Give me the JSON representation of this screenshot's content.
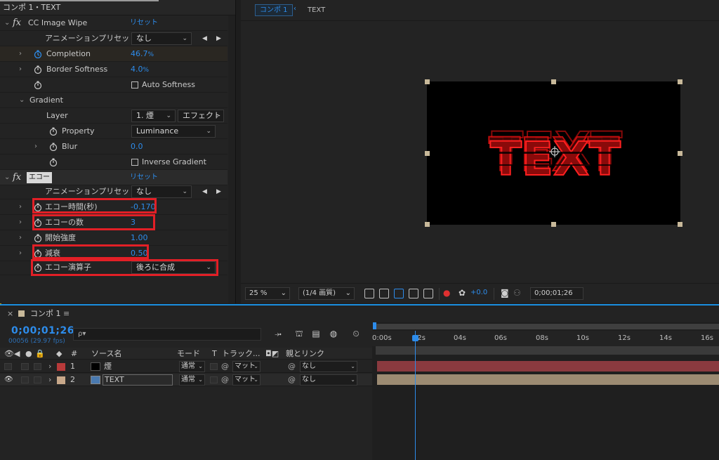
{
  "effects_panel": {
    "title": "コンポ 1・TEXT",
    "cc_image_wipe": {
      "name": "CC Image Wipe",
      "reset": "リセット",
      "anim_preset_label": "アニメーションプリセット：",
      "anim_preset_value": "なし",
      "completion_label": "Completion",
      "completion_value": "46.7",
      "completion_unit": "%",
      "border_softness_label": "Border Softness",
      "border_softness_value": "4.0",
      "border_softness_unit": "%",
      "auto_softness_label": "Auto Softness",
      "gradient_label": "Gradient",
      "layer_label": "Layer",
      "layer_value": "1. 煙",
      "layer_source": "エフェクト",
      "property_label": "Property",
      "property_value": "Luminance",
      "blur_label": "Blur",
      "blur_value": "0.0",
      "inverse_gradient_label": "Inverse Gradient"
    },
    "echo": {
      "name": "エコー",
      "reset": "リセット",
      "anim_preset_label": "アニメーションプリセット：",
      "anim_preset_value": "なし",
      "echo_time_label": "エコー時間(秒)",
      "echo_time_value": "-0.170",
      "num_echoes_label": "エコーの数",
      "num_echoes_value": "3",
      "start_intensity_label": "開始強度",
      "start_intensity_value": "1.00",
      "decay_label": "減衰",
      "decay_value": "0.50",
      "operator_label": "エコー演算子",
      "operator_value": "後ろに合成"
    }
  },
  "viewer": {
    "comp_tab": "コンポ 1",
    "layer_crumb": "TEXT",
    "canvas_text": "TEXT",
    "zoom": "25 %",
    "resolution": "(1/4 画質)",
    "exposure": "+0.0",
    "timecode": "0;00;01;26"
  },
  "timeline": {
    "tab_label": "コンポ 1",
    "timecode": "0;00;01;26",
    "frames": "00056 (29.97 fps)",
    "search_placeholder": "ρ▾",
    "columns": {
      "num": "#",
      "source": "ソース名",
      "mode": "モード",
      "t": "T",
      "track": "トラック...",
      "parent": "親とリンク"
    },
    "ruler": [
      "0:00s",
      "02s",
      "04s",
      "06s",
      "08s",
      "10s",
      "12s",
      "14s",
      "16s"
    ],
    "layers": [
      {
        "num": "1",
        "name": "煙",
        "mode": "通常",
        "track": "マット",
        "parent": "なし",
        "label_color": "#b83a3a",
        "bar_color": "#8a3a3f"
      },
      {
        "num": "2",
        "name": "TEXT",
        "mode": "通常",
        "track": "マット",
        "parent": "なし",
        "label_color": "#c8a88a",
        "bar_color": "#9c8b72"
      }
    ]
  },
  "colors": {
    "accent": "#2d8ceb",
    "highlight_box": "#e21f26",
    "text_red": "#e01010"
  }
}
